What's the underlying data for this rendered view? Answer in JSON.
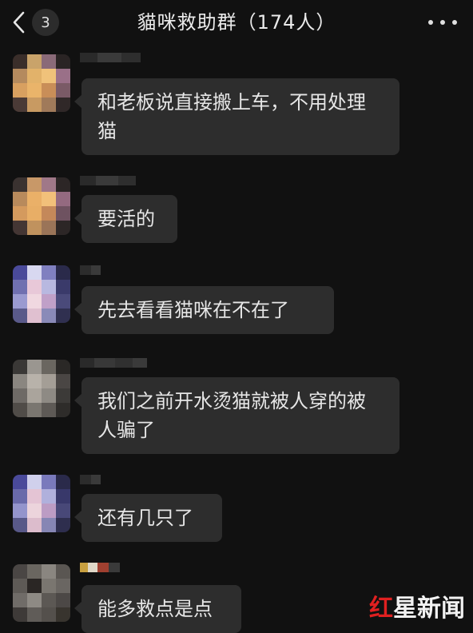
{
  "header": {
    "unread_count": "3",
    "title": "貓咪救助群（174人）"
  },
  "messages": [
    {
      "text": "和老板说直接搬上车，不用处理猫"
    },
    {
      "text": "要活的"
    },
    {
      "text": "先去看看猫咪在不在了"
    },
    {
      "text": "我们之前开水烫猫就被人穿的被人骗了"
    },
    {
      "text": "还有几只了"
    },
    {
      "text": "能多救点是点"
    }
  ],
  "watermark": {
    "accent": "红",
    "rest": "星新闻"
  },
  "colors": {
    "background": "#111111",
    "bubble": "#2d2d2d",
    "text": "#e6e6e6",
    "watermark_red": "#e02020"
  }
}
